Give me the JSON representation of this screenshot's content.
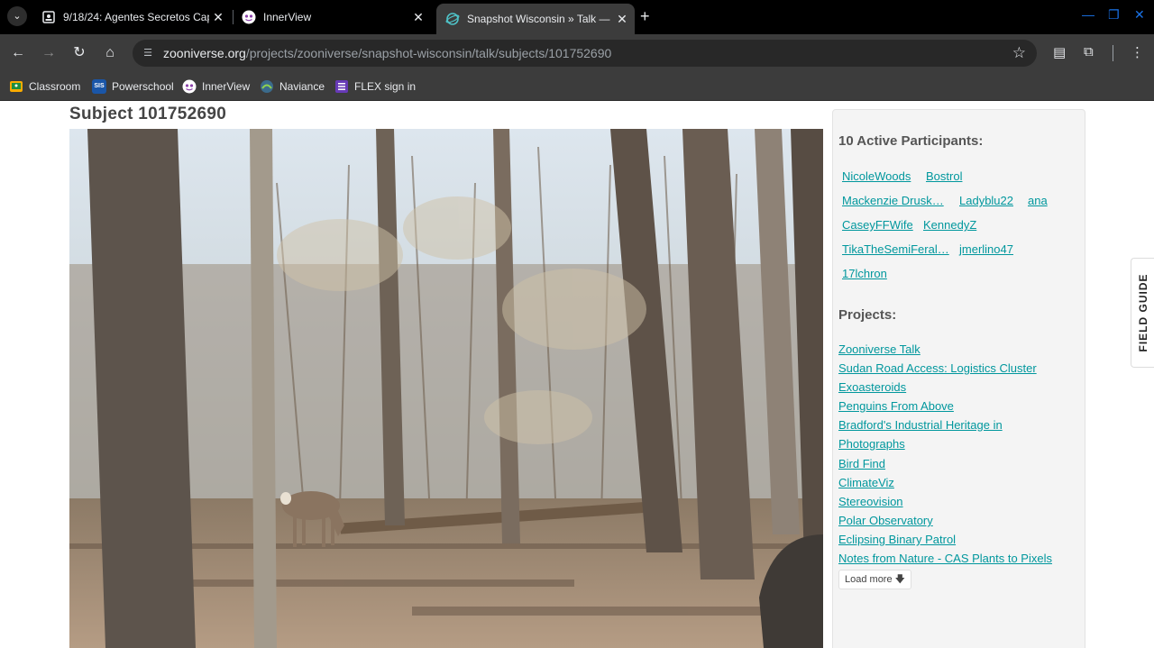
{
  "browser": {
    "tabs": [
      {
        "title": "9/18/24: Agentes Secretos Cap",
        "icon": "document-icon"
      },
      {
        "title": "InnerView",
        "icon": "innerview-icon"
      },
      {
        "title": "Snapshot Wisconsin » Talk — Z",
        "icon": "zooniverse-icon"
      }
    ],
    "url_host": "zooniverse.org",
    "url_path": "/projects/zooniverse/snapshot-wisconsin/talk/subjects/101752690",
    "bookmarks": [
      {
        "label": "Classroom",
        "icon": "classroom-icon",
        "color": "#f9ab00"
      },
      {
        "label": "Powerschool",
        "icon": "sis-icon",
        "color": "#1a56a8",
        "badge": "SIS"
      },
      {
        "label": "InnerView",
        "icon": "innerview-icon",
        "color": "#ffffff"
      },
      {
        "label": "Naviance",
        "icon": "naviance-icon",
        "color": "#3b6b8c"
      },
      {
        "label": "FLEX sign in",
        "icon": "form-icon",
        "color": "#673ab7"
      }
    ]
  },
  "page": {
    "subject_title": "Subject 101752690",
    "participants_heading": "10 Active Participants:",
    "participants": [
      "NicoleWoods",
      "Bostrol",
      "Mackenzie Drusk…",
      "Ladyblu22",
      "ana",
      "CaseyFFWife",
      "KennedyZ",
      "TikaTheSemiFeral…",
      "jmerlino47",
      "17lchron"
    ],
    "projects_heading": "Projects:",
    "projects": [
      "Zooniverse Talk",
      "Sudan Road Access: Logistics Cluster",
      "Exoasteroids",
      "Penguins From Above",
      "Bradford's Industrial Heritage in",
      "Photographs",
      "Bird Find",
      "ClimateViz",
      "Stereovision",
      "Polar Observatory",
      "Eclipsing Binary Patrol",
      "Notes from Nature - CAS Plants to Pixels"
    ],
    "load_more": "Load more",
    "field_guide": "FIELD GUIDE"
  },
  "colors": {
    "link": "#00979d",
    "chrome_dark": "#000000",
    "chrome_toolbar": "#3c3c3c"
  }
}
